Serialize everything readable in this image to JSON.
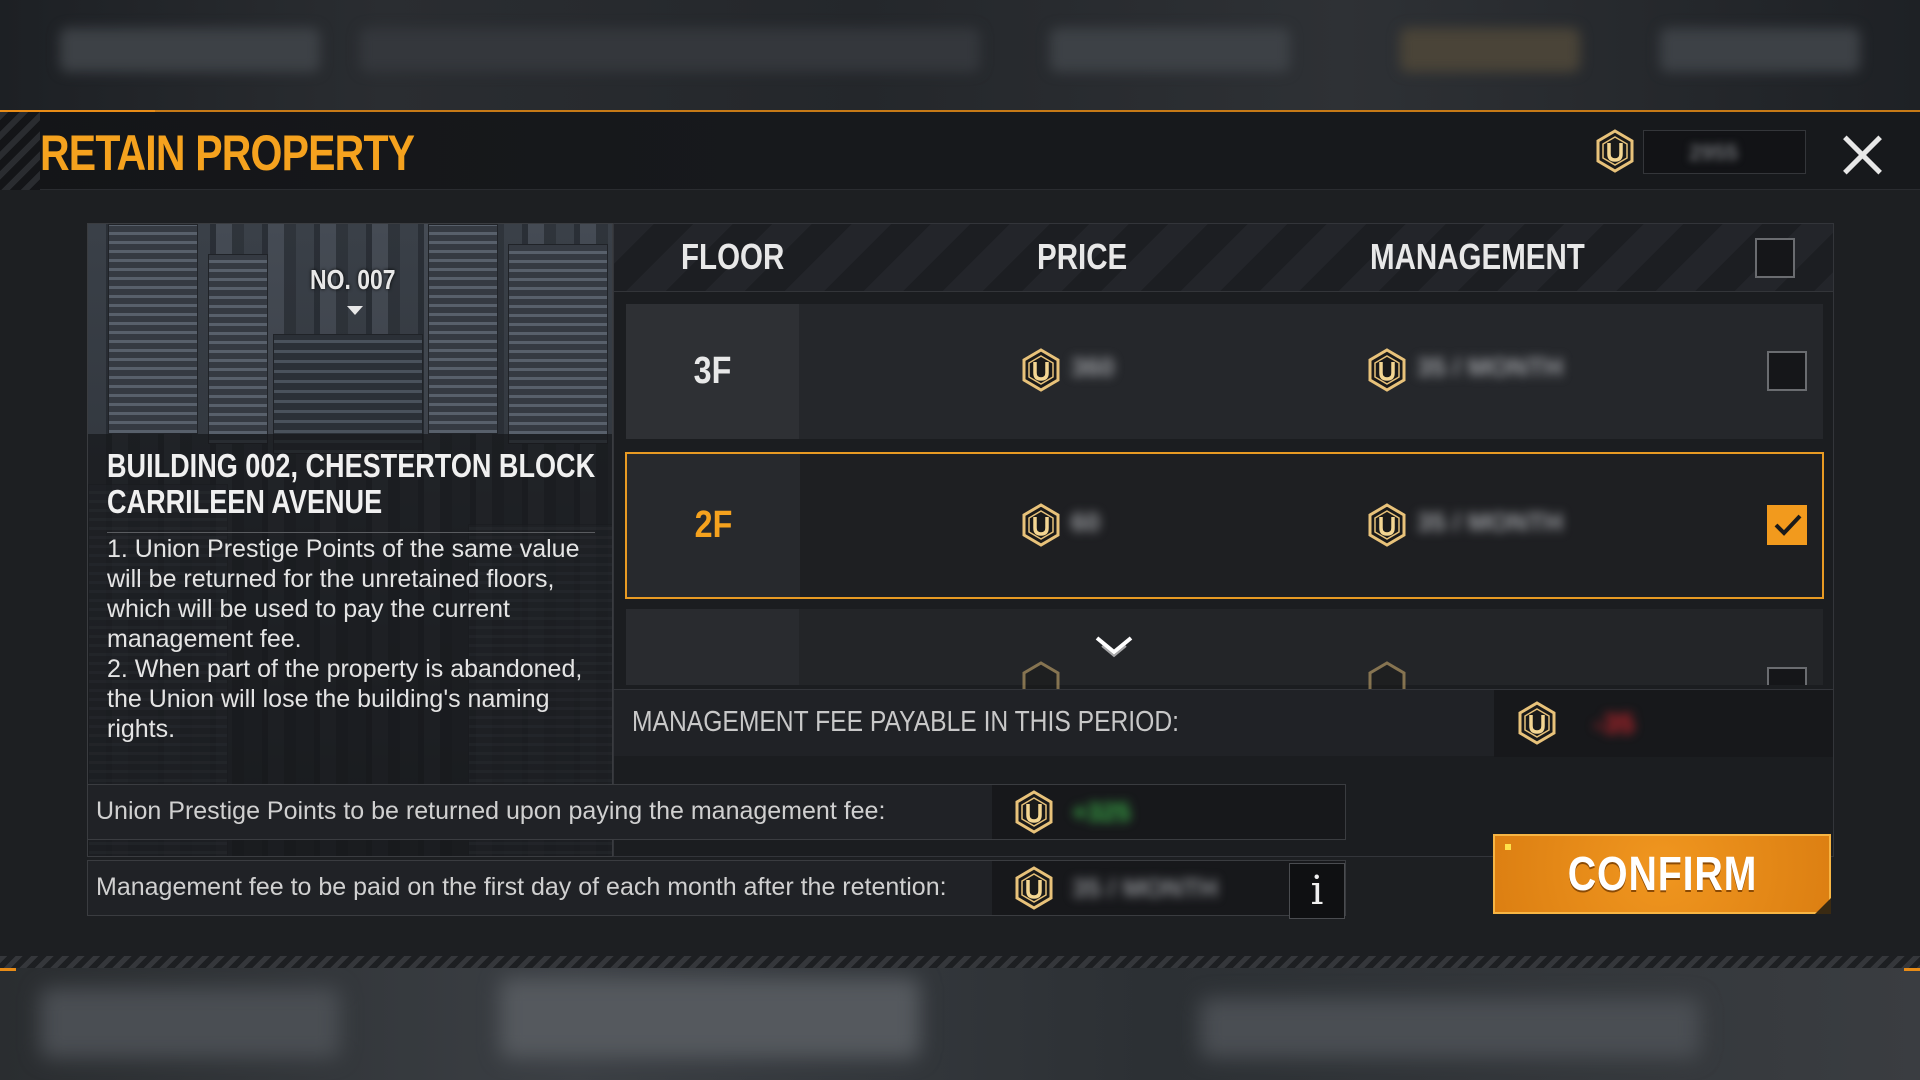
{
  "header": {
    "title": "RETAIN PROPERTY",
    "currency_value": "2955"
  },
  "building": {
    "number_label": "NO. 007",
    "name_line1": "BUILDING 002, CHESTERTON BLOCK",
    "name_line2": "CARRILEEN AVENUE",
    "note1": "1. Union Prestige Points of the same value will be returned for the unretained floors, which will be used to pay the current management fee.",
    "note2": "2. When part of the property is abandoned, the Union will lose the building's naming rights."
  },
  "table": {
    "headers": {
      "floor": "FLOOR",
      "price": "PRICE",
      "management": "MANAGEMENT"
    },
    "rows": [
      {
        "floor": "3F",
        "price": "360",
        "management": "35 / MONTH",
        "checked": false
      },
      {
        "floor": "2F",
        "price": "60",
        "management": "35 / MONTH",
        "checked": true
      }
    ],
    "fee_label": "MANAGEMENT FEE PAYABLE IN THIS PERIOD:",
    "fee_value": "-35"
  },
  "summary": {
    "returned_label": "Union Prestige Points to be returned upon paying the management fee:",
    "returned_value": "+325",
    "monthly_label": "Management fee to be paid on the first day of each month after the retention:",
    "monthly_value": "35 / MONTH",
    "info_glyph": "i"
  },
  "confirm_label": "CONFIRM",
  "colors": {
    "accent": "#f5a21e",
    "selected_border": "#e89a23",
    "green": "#3cb24a",
    "red": "#c0262d"
  },
  "icons": [
    "union-coin-icon",
    "close-icon",
    "checkmark-icon",
    "chevron-down-icon",
    "info-icon"
  ]
}
